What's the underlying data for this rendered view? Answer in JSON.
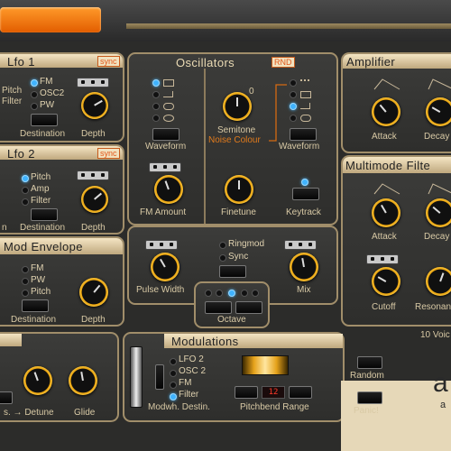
{
  "lfo1": {
    "title": "Lfo 1",
    "sync": "sync",
    "side_labels": [
      "Pitch",
      "Filter"
    ],
    "options": [
      "FM",
      "OSC2",
      "PW"
    ],
    "destination": "Destination",
    "depth": "Depth"
  },
  "lfo2": {
    "title": "Lfo 2",
    "sync": "sync",
    "options": [
      "Pitch",
      "Amp",
      "Filter"
    ],
    "left_cut": "n",
    "destination": "Destination",
    "depth": "Depth"
  },
  "modenv": {
    "title": "Mod Envelope",
    "options": [
      "FM",
      "PW",
      "Pitch"
    ],
    "destination": "Destination",
    "depth": "Depth"
  },
  "osc": {
    "title": "Oscillators",
    "rnd": "RND",
    "waveform1": "Waveform",
    "fm_amount": "FM Amount",
    "semitone": "Semitone",
    "semitone_value": "0",
    "noise_colour": "Noise Colour",
    "finetune": "Finetune",
    "waveform2": "Waveform",
    "keytrack": "Keytrack",
    "pulse_width": "Pulse Width",
    "ringmod": "Ringmod",
    "sync": "Sync",
    "mix": "Mix",
    "octave": "Octave"
  },
  "amp": {
    "title": "Amplifier",
    "attack": "Attack",
    "decay": "Decay"
  },
  "filter": {
    "title": "Multimode Filte",
    "attack": "Attack",
    "decay": "Decay",
    "cutoff": "Cutoff",
    "resonance": "Resonan"
  },
  "voices": "10 Voic",
  "bottom": {
    "detune": "s. → Detune",
    "glide": "Glide"
  },
  "mods": {
    "title": "Modulations",
    "options": [
      "LFO 2",
      "OSC 2",
      "FM",
      "Filter"
    ],
    "modwh": "Modwh. Destin.",
    "pitchbend": "Pitchbend Range",
    "pitch_value": "12"
  },
  "side": {
    "random": "Random",
    "panic": "Panic!"
  },
  "logo": {
    "big": "a",
    "small": "a"
  }
}
